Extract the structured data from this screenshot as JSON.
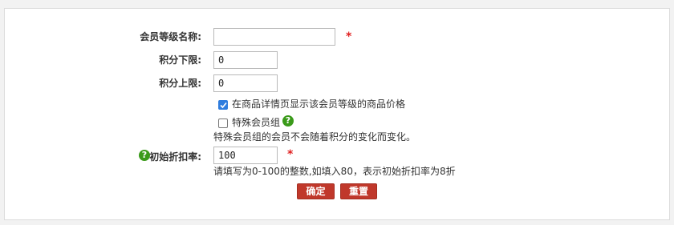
{
  "form": {
    "level_name": {
      "label": "会员等级名称:",
      "value": "",
      "required_mark": "*"
    },
    "points_min": {
      "label": "积分下限:",
      "value": "0"
    },
    "points_max": {
      "label": "积分上限:",
      "value": "0"
    },
    "show_price": {
      "label": "在商品详情页显示该会员等级的商品价格",
      "checked": true
    },
    "special_group": {
      "label": "特殊会员组",
      "checked": false,
      "help_glyph": "?",
      "note": "特殊会员组的会员不会随着积分的变化而变化。"
    },
    "discount": {
      "label": "初始折扣率:",
      "value": "100",
      "required_mark": "*",
      "help_glyph": "?",
      "hint": "请填写为0-100的整数,如填入80，表示初始折扣率为8折"
    },
    "buttons": {
      "confirm": "确定",
      "reset": "重置"
    }
  },
  "colors": {
    "accent": "#c0382b",
    "required": "#e02020",
    "checkbox": "#2f7dde",
    "help": "#3a9a1a"
  }
}
